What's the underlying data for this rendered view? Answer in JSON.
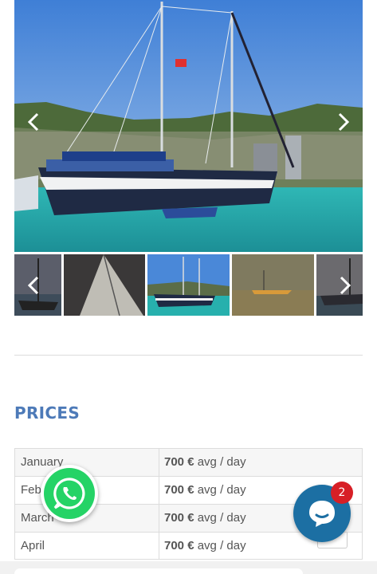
{
  "gallery": {
    "main_image": "gulet-sailing-yacht-harbor-photo",
    "prev_icon": "chevron-left-icon",
    "next_icon": "chevron-right-icon",
    "thumbnails": [
      "gulet-dusk-thumb",
      "sail-closeup-thumb",
      "gulet-harbor-thumb",
      "gulet-sea-sunset-thumb",
      "gulet-evening-thumb"
    ]
  },
  "prices": {
    "title": "PRICES",
    "rows": [
      {
        "month": "January",
        "amount": "700 €",
        "unit": "avg / day"
      },
      {
        "month": "February",
        "amount": "700 €",
        "unit": "avg / day"
      },
      {
        "month": "March",
        "amount": "700 €",
        "unit": "avg / day"
      },
      {
        "month": "April",
        "amount": "700 €",
        "unit": "avg / day"
      }
    ]
  },
  "whatsapp": {
    "icon": "whatsapp-icon",
    "color": "#25d366"
  },
  "chat": {
    "icon": "chat-bubble-icon",
    "badge": "2",
    "color": "#1c6fa3",
    "badge_color": "#d71f26"
  },
  "colors": {
    "accent": "#4d7ab8"
  }
}
